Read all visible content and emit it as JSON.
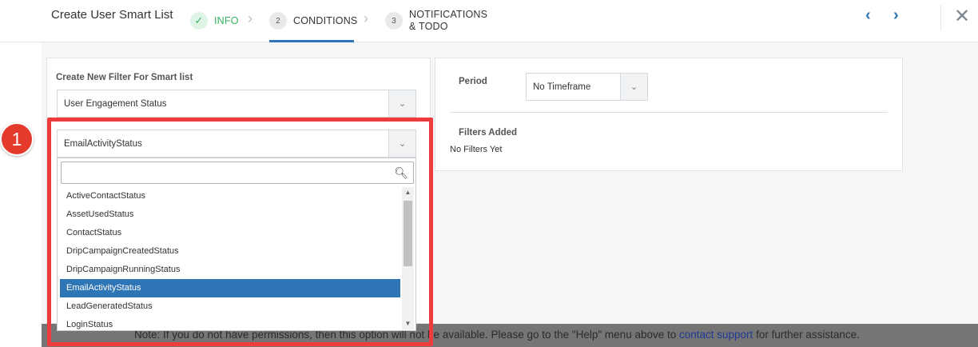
{
  "header": {
    "title": "Create User Smart List",
    "steps": [
      {
        "number": "✓",
        "label": "INFO",
        "status": "complete"
      },
      {
        "number": "2",
        "label": "CONDITIONS",
        "status": "active"
      },
      {
        "number": "3",
        "label": "NOTIFICATIONS & TODO",
        "status": "pending"
      }
    ],
    "prev_icon": "chevron-left-icon",
    "next_icon": "chevron-right-icon",
    "close_icon": "close-icon"
  },
  "left_panel": {
    "filter_label": "Create New Filter For Smart list",
    "category_select": "User Engagement Status",
    "status_select": "EmailActivityStatus",
    "dropdown": {
      "search_value": "",
      "items": [
        "ActiveContactStatus",
        "AssetUsedStatus",
        "ContactStatus",
        "DripCampaignCreatedStatus",
        "DripCampaignRunningStatus",
        "EmailActivityStatus",
        "LeadGeneratedStatus",
        "LoginStatus"
      ],
      "selected": "EmailActivityStatus"
    }
  },
  "right_panel": {
    "period_label": "Period",
    "period_value": "No Timeframe",
    "filters_added_label": "Filters Added",
    "filters_empty_text": "No Filters Yet"
  },
  "footer": {
    "note_prefix": "Note: If you do not have permissions, then this option will not be available. Please go to the \"Help\" menu above to ",
    "link_text": "contact support",
    "note_suffix": " for further assistance."
  },
  "callout": {
    "number": "1"
  },
  "colors": {
    "accent": "#2e75b6",
    "success": "#36b360",
    "callout_red": "#ee3b3b"
  }
}
